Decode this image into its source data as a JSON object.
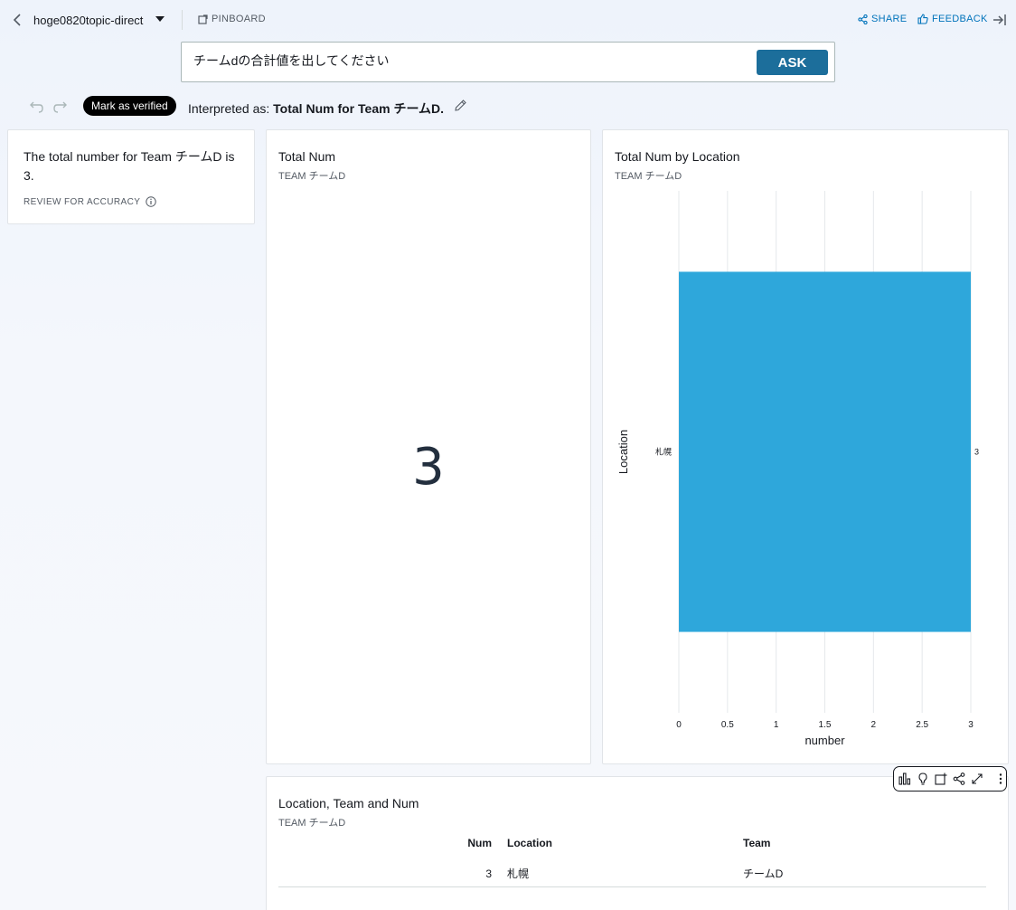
{
  "header": {
    "topic_name": "hoge0820topic-direct",
    "pinboard_label": "PINBOARD",
    "share_label": "SHARE",
    "feedback_label": "FEEDBACK"
  },
  "ask": {
    "query": "チームdの合計値を出してください",
    "button_label": "ASK"
  },
  "answer_bar": {
    "verify_label": "Mark as verified",
    "interpreted_prefix": "Interpreted as: ",
    "interpreted_value": "Total Num for Team チームD."
  },
  "summary": {
    "text": "The total number for Team チームD is 3.",
    "review_label": "REVIEW FOR ACCURACY"
  },
  "kpi": {
    "title": "Total Num",
    "subtitle": "TEAM チームD",
    "value": "3"
  },
  "bar_chart": {
    "title": "Total Num by Location",
    "subtitle": "TEAM チームD"
  },
  "chart_data": {
    "type": "bar",
    "orientation": "horizontal",
    "categories": [
      "札幌"
    ],
    "values": [
      3
    ],
    "data_labels": [
      "3"
    ],
    "xlabel": "number",
    "ylabel": "Location",
    "xlim": [
      0,
      3
    ],
    "xticks": [
      "0",
      "0.5",
      "1",
      "1.5",
      "2",
      "2.5",
      "3"
    ],
    "grid": true,
    "bar_color": "#2ea7db"
  },
  "table": {
    "title": "Location, Team and Num",
    "subtitle": "TEAM チームD",
    "headers": {
      "num": "Num",
      "location": "Location",
      "team": "Team"
    },
    "rows": [
      {
        "num": "3",
        "location": "札幌",
        "team": "チームD"
      }
    ]
  },
  "colors": {
    "accent": "#1c6e9b",
    "link": "#0073bb",
    "bar": "#2ea7db"
  }
}
